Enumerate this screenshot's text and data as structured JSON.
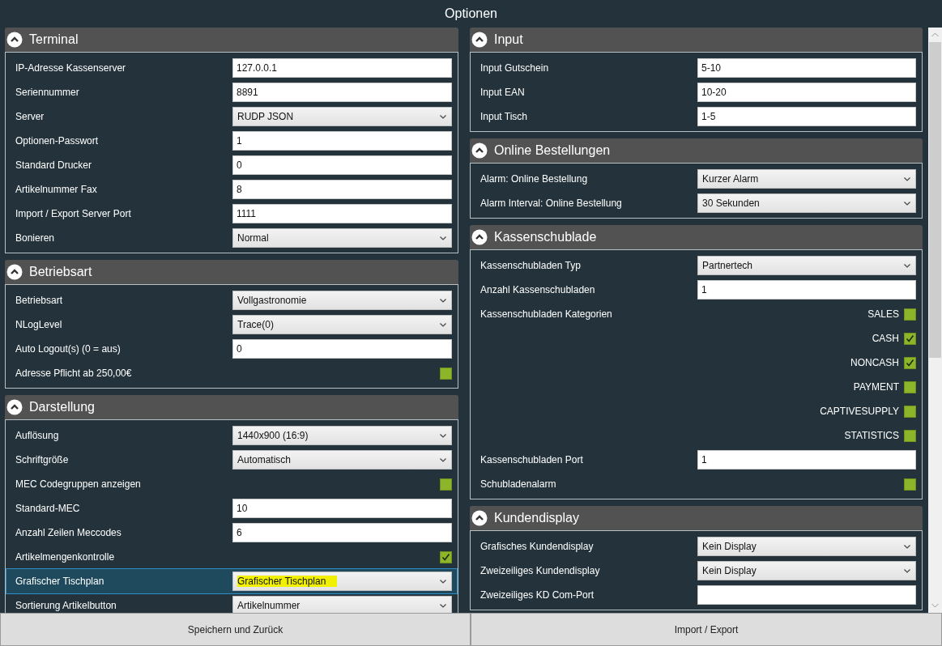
{
  "window": {
    "title": "Optionen"
  },
  "columns": [
    {
      "sections": [
        {
          "title": "Terminal",
          "expanded": true,
          "rows": [
            {
              "label": "IP-Adresse Kassenserver",
              "kind": "text",
              "value": "127.0.0.1",
              "selected": false
            },
            {
              "label": "Seriennummer",
              "kind": "text",
              "value": "8891",
              "selected": false
            },
            {
              "label": "Server",
              "kind": "select",
              "value": "RUDP JSON",
              "selected": false
            },
            {
              "label": "Optionen-Passwort",
              "kind": "text",
              "value": "1",
              "selected": false
            },
            {
              "label": "Standard Drucker",
              "kind": "text",
              "value": "0",
              "selected": false
            },
            {
              "label": "Artikelnummer Fax",
              "kind": "text",
              "value": "8",
              "selected": false
            },
            {
              "label": "Import / Export Server Port",
              "kind": "text",
              "value": "1111",
              "selected": false
            },
            {
              "label": "Bonieren",
              "kind": "select",
              "value": "Normal",
              "selected": false
            }
          ]
        },
        {
          "title": "Betriebsart",
          "expanded": true,
          "rows": [
            {
              "label": "Betriebsart",
              "kind": "select",
              "value": "Vollgastronomie",
              "selected": false
            },
            {
              "label": "NLogLevel",
              "kind": "select",
              "value": "Trace(0)",
              "selected": false
            },
            {
              "label": "Auto Logout(s) (0 = aus)",
              "kind": "text",
              "value": "0",
              "selected": false
            },
            {
              "label": "Adresse Pflicht ab 250,00€",
              "kind": "checkbox",
              "checked": false,
              "selected": false
            }
          ]
        },
        {
          "title": "Darstellung",
          "expanded": true,
          "rows": [
            {
              "label": "Auflösung",
              "kind": "select",
              "value": "1440x900 (16:9)",
              "selected": false
            },
            {
              "label": "Schriftgröße",
              "kind": "select",
              "value": "Automatisch",
              "selected": false
            },
            {
              "label": "MEC Codegruppen anzeigen",
              "kind": "checkbox",
              "checked": false,
              "selected": false
            },
            {
              "label": "Standard-MEC",
              "kind": "text",
              "value": "10",
              "selected": false
            },
            {
              "label": "Anzahl Zeilen Meccodes",
              "kind": "text",
              "value": "6",
              "selected": false
            },
            {
              "label": "Artikelmengenkontrolle",
              "kind": "checkbox",
              "checked": true,
              "selected": false
            },
            {
              "label": "Grafischer Tischplan",
              "kind": "select",
              "value": "Grafischer Tischplan",
              "selected": true
            },
            {
              "label": "Sortierung Artikelbutton",
              "kind": "select",
              "value": "Artikelnummer",
              "selected": false
            }
          ]
        }
      ]
    },
    {
      "sections": [
        {
          "title": "Input",
          "expanded": true,
          "rows": [
            {
              "label": "Input Gutschein",
              "kind": "text",
              "value": "5-10",
              "selected": false
            },
            {
              "label": "Input EAN",
              "kind": "text",
              "value": "10-20",
              "selected": false
            },
            {
              "label": "Input Tisch",
              "kind": "text",
              "value": "1-5",
              "selected": false
            }
          ]
        },
        {
          "title": "Online Bestellungen",
          "expanded": true,
          "rows": [
            {
              "label": "Alarm: Online Bestellung",
              "kind": "select",
              "value": "Kurzer Alarm",
              "selected": false
            },
            {
              "label": "Alarm Interval: Online Bestellung",
              "kind": "select",
              "value": "30 Sekunden",
              "selected": false
            }
          ]
        },
        {
          "title": "Kassenschublade",
          "expanded": true,
          "rows": [
            {
              "label": "Kassenschubladen Typ",
              "kind": "select",
              "value": "Partnertech",
              "selected": false
            },
            {
              "label": "Anzahl Kassenschubladen",
              "kind": "text",
              "value": "1",
              "selected": false
            },
            {
              "label": "Kassenschubladen Kategorien",
              "kind": "checklist",
              "selected": false,
              "items": [
                {
                  "label": "SALES",
                  "checked": false
                },
                {
                  "label": "CASH",
                  "checked": true
                },
                {
                  "label": "NONCASH",
                  "checked": true
                },
                {
                  "label": "PAYMENT",
                  "checked": false
                },
                {
                  "label": "CAPTIVESUPPLY",
                  "checked": false
                },
                {
                  "label": "STATISTICS",
                  "checked": false
                }
              ]
            },
            {
              "label": "Kassenschubladen Port",
              "kind": "text",
              "value": "1",
              "selected": false
            },
            {
              "label": "Schubladenalarm",
              "kind": "checkbox",
              "checked": false,
              "selected": false
            }
          ]
        },
        {
          "title": "Kundendisplay",
          "expanded": true,
          "rows": [
            {
              "label": "Grafisches Kundendisplay",
              "kind": "select",
              "value": "Kein Display",
              "selected": false
            },
            {
              "label": "Zweizeiliges Kundendisplay",
              "kind": "select",
              "value": "Kein Display",
              "selected": false
            },
            {
              "label": "Zweizeiliges KD Com-Port",
              "kind": "text",
              "value": "",
              "selected": false
            }
          ]
        }
      ]
    }
  ],
  "footer": {
    "buttons": [
      "Speichern und Zurück",
      "Import / Export"
    ]
  }
}
